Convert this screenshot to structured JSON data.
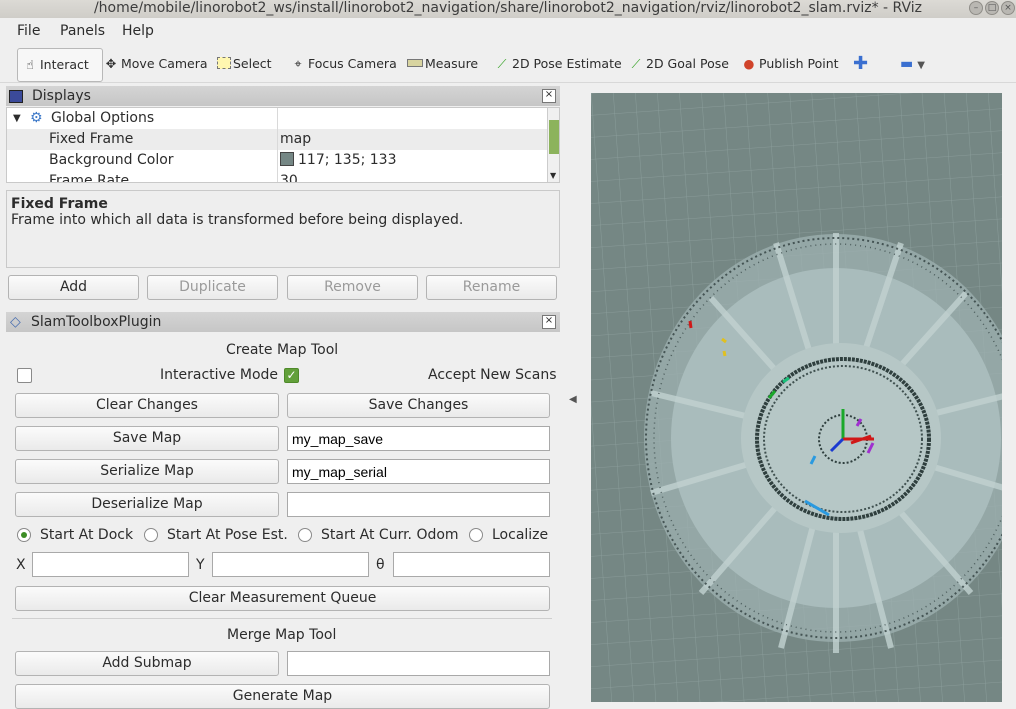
{
  "window": {
    "title": "/home/mobile/linorobot2_ws/install/linorobot2_navigation/share/linorobot2_navigation/rviz/linorobot2_slam.rviz* - RViz"
  },
  "menu": {
    "items": [
      "File",
      "Panels",
      "Help"
    ]
  },
  "toolbar": {
    "interact": "Interact",
    "move_camera": "Move Camera",
    "select": "Select",
    "focus_camera": "Focus Camera",
    "measure": "Measure",
    "pose_estimate": "2D Pose Estimate",
    "goal_pose": "2D Goal Pose",
    "publish_point": "Publish Point"
  },
  "displays": {
    "title": "Displays",
    "global_options": "Global Options",
    "rows": [
      {
        "name": "Fixed Frame",
        "value": "map"
      },
      {
        "name": "Background Color",
        "value": "117; 135; 133"
      },
      {
        "name": "Frame Rate",
        "value": "30"
      }
    ],
    "bg_color": "#758785",
    "desc_title": "Fixed Frame",
    "desc_text": "Frame into which all data is transformed before being displayed.",
    "buttons": {
      "add": "Add",
      "duplicate": "Duplicate",
      "remove": "Remove",
      "rename": "Rename"
    }
  },
  "slam": {
    "title": "SlamToolboxPlugin",
    "create_map_tool": "Create Map Tool",
    "interactive_mode": "Interactive Mode",
    "accept_new_scans": "Accept New Scans",
    "clear_changes": "Clear Changes",
    "save_changes": "Save Changes",
    "save_map": "Save Map",
    "save_map_value": "my_map_save",
    "serialize_map": "Serialize Map",
    "serialize_map_value": "my_map_serial",
    "deserialize_map": "Deserialize Map",
    "deserialize_map_value": "",
    "radios": [
      "Start At Dock",
      "Start At Pose Est.",
      "Start At Curr. Odom",
      "Localize"
    ],
    "x_label": "X",
    "y_label": "Y",
    "theta_label": "θ",
    "clear_measurement_queue": "Clear Measurement Queue",
    "merge_map_tool": "Merge Map Tool",
    "add_submap": "Add Submap",
    "add_submap_value": "",
    "generate_map": "Generate Map"
  },
  "colors": {
    "viewport_bg": "#758784",
    "map_free": "#a9bcbc",
    "map_occupied": "#2f3f3e",
    "accent": "#62a03a"
  }
}
